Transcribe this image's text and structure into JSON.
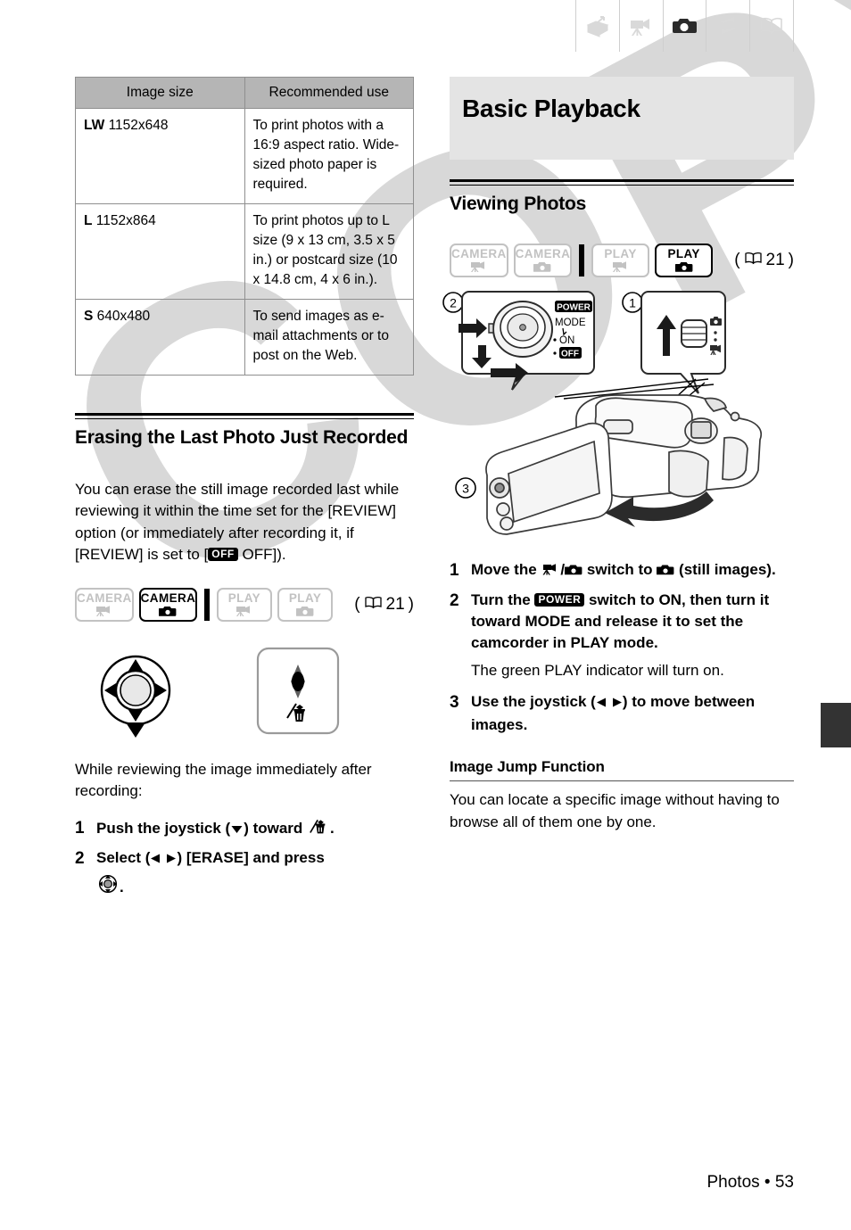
{
  "page": {
    "footer_text": "Photos • 53",
    "watermark": "COPY",
    "band_color": "#e4e4e4",
    "table_header_color": "#b5b5b5",
    "edge_tab_color": "#333333"
  },
  "chapter_tabs": [
    {
      "name": "intro-box-icon",
      "active": false
    },
    {
      "name": "camcorder-icon",
      "active": false
    },
    {
      "name": "photo-camera-icon",
      "active": true
    },
    {
      "name": "exchange-arrows-icon",
      "active": false
    },
    {
      "name": "open-book-icon",
      "active": false
    }
  ],
  "left_column": {
    "table": {
      "headers": [
        "Image size",
        "Recommended use"
      ],
      "rows": [
        {
          "code": "LW",
          "size": "1152x648",
          "use": "To print photos with a 16:9 aspect ratio. Wide-sized photo paper is required."
        },
        {
          "code": "L",
          "size": "1152x864",
          "use": "To print photos up to L size (9 x 13 cm, 3.5 x 5 in.) or postcard size (10 x 14.8 cm, 4 x 6 in.)."
        },
        {
          "code": "S",
          "size": "640x480",
          "use": "To send images as e-mail attachments or to post on the Web."
        }
      ]
    },
    "section_heading": "Erasing the Last Photo Just Recorded",
    "intro_part1": "You can erase the still image recorded last while reviewing it within the time set for the [REVIEW] option (or immediately after recording it, if [REVIEW] is set to [",
    "intro_badge": "OFF",
    "intro_part2": " OFF]).",
    "mode_badges": [
      {
        "label": "CAMERA",
        "icon": "video-camera-icon",
        "active": false
      },
      {
        "label": "CAMERA",
        "icon": "still-camera-icon",
        "active": true
      },
      {
        "label": "PLAY",
        "icon": "video-camera-icon",
        "active": false
      },
      {
        "label": "PLAY",
        "icon": "still-camera-icon",
        "active": false
      }
    ],
    "page_ref": "21",
    "lead_in": "While reviewing the image immediately after recording:",
    "steps": [
      {
        "num": "1",
        "text_before": "Push the joystick (",
        "arrow": "down",
        "text_after": ") toward",
        "trailing": "."
      },
      {
        "num": "2",
        "text_before": "Select (",
        "arrow": "leftright",
        "text_after": ") [ERASE] and press",
        "trailing": "."
      }
    ]
  },
  "right_column": {
    "band_title": "Basic Playback",
    "section_heading": "Viewing Photos",
    "mode_badges": [
      {
        "label": "CAMERA",
        "icon": "video-camera-icon",
        "active": false
      },
      {
        "label": "CAMERA",
        "icon": "still-camera-icon",
        "active": false
      },
      {
        "label": "PLAY",
        "icon": "video-camera-icon",
        "active": false
      },
      {
        "label": "PLAY",
        "icon": "still-camera-icon",
        "active": true
      }
    ],
    "page_ref": "21",
    "figure": {
      "callouts": [
        "1",
        "2",
        "3"
      ],
      "power_dial": {
        "title": "POWER",
        "labels": [
          "MODE",
          "ON",
          "OFF"
        ]
      }
    },
    "steps": [
      {
        "num": "1",
        "part1": "Move the",
        "part2": "/",
        "part3": "switch to",
        "part4": "(still images)."
      },
      {
        "num": "2",
        "part1": "Turn the",
        "badge": "POWER",
        "part2": "switch to ON, then turn it toward MODE and release it to set the camcorder in PLAY mode.",
        "note": "The green PLAY indicator will turn on."
      },
      {
        "num": "3",
        "part1": "Use the joystick (",
        "part2": ") to move between images."
      }
    ],
    "subsection_heading": "Image Jump Function",
    "subsection_body": "You can locate a specific image without having to browse all of them one by one."
  }
}
